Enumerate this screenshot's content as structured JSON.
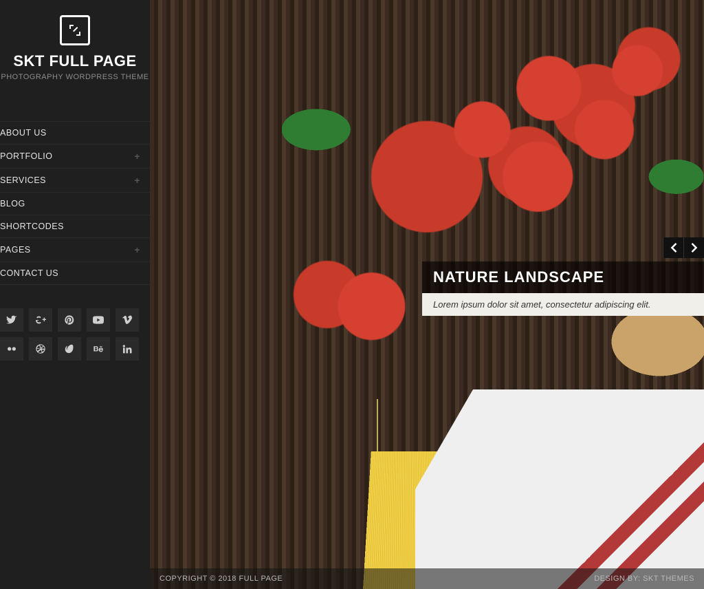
{
  "site": {
    "title": "SKT FULL PAGE",
    "tagline": "PHOTOGRAPHY WORDPRESS THEME"
  },
  "nav": {
    "items": [
      {
        "label": "ABOUT US",
        "expandable": false
      },
      {
        "label": "PORTFOLIO",
        "expandable": true
      },
      {
        "label": "SERVICES",
        "expandable": true
      },
      {
        "label": "BLOG",
        "expandable": false
      },
      {
        "label": "SHORTCODES",
        "expandable": false
      },
      {
        "label": "PAGES",
        "expandable": true
      },
      {
        "label": "CONTACT US",
        "expandable": false
      }
    ]
  },
  "social": [
    {
      "name": "twitter"
    },
    {
      "name": "google-plus"
    },
    {
      "name": "pinterest"
    },
    {
      "name": "youtube"
    },
    {
      "name": "vimeo"
    },
    {
      "name": "flickr"
    },
    {
      "name": "dribbble"
    },
    {
      "name": "envato"
    },
    {
      "name": "behance"
    },
    {
      "name": "linkedin"
    }
  ],
  "slider": {
    "caption_title": "NATURE LANDSCAPE",
    "caption_text": "Lorem ipsum dolor sit amet, consectetur adipiscing elit."
  },
  "footer": {
    "left": "COPYRIGHT © 2018 FULL PAGE",
    "right": "DESIGN BY: SKT THEMES"
  }
}
